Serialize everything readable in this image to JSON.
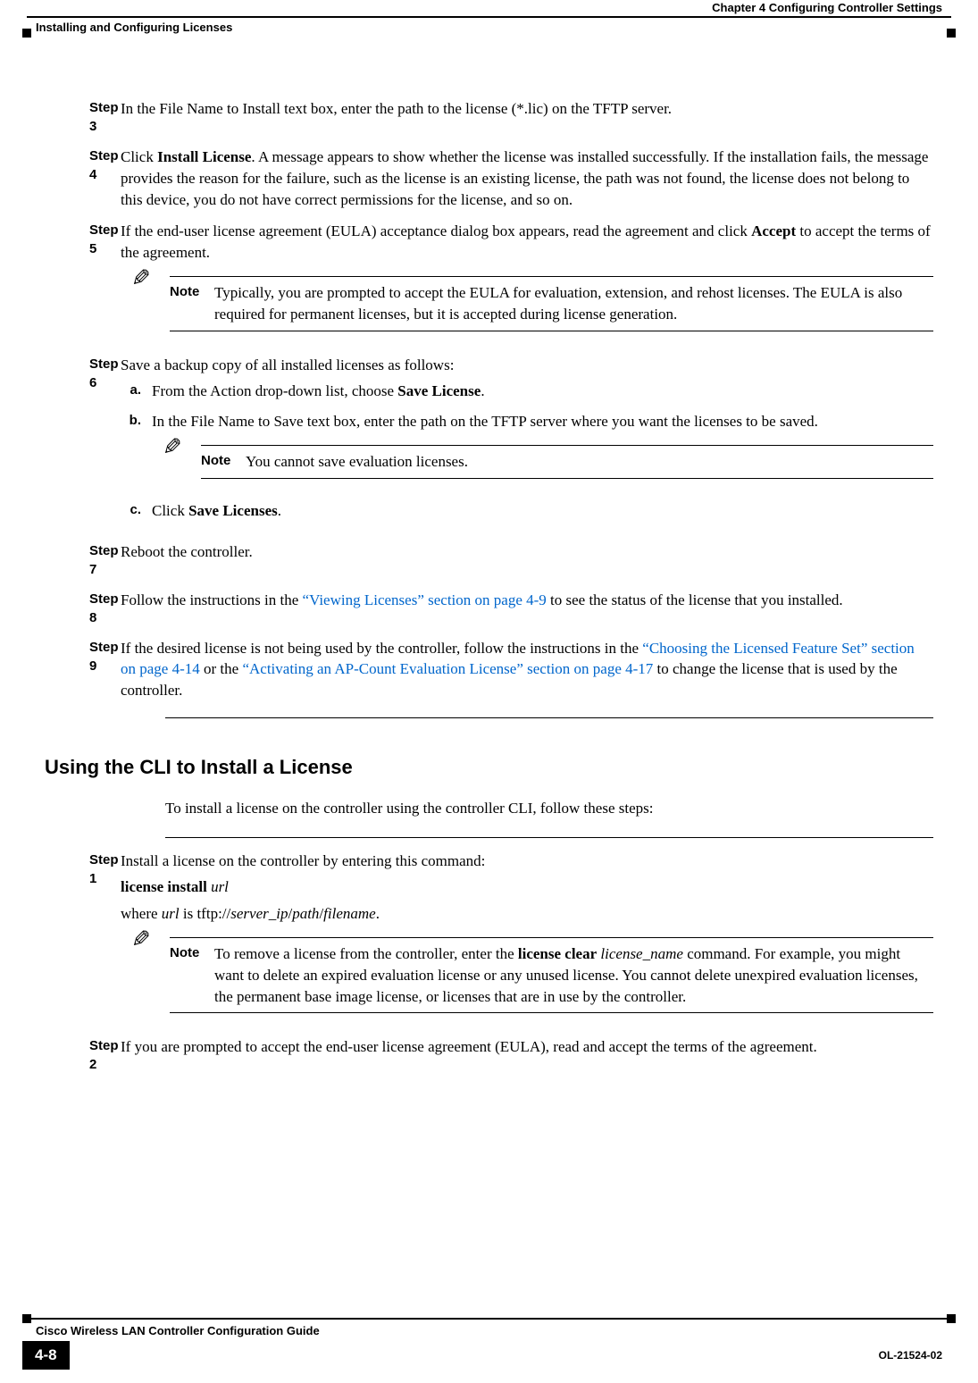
{
  "header": {
    "chapter": "Chapter 4      Configuring Controller Settings",
    "section": "Installing and Configuring Licenses"
  },
  "steps_a": {
    "s3": {
      "label": "Step 3",
      "text": "In the File Name to Install text box, enter the path to the license (*.lic) on the TFTP server."
    },
    "s4": {
      "label": "Step 4",
      "prefix": "Click ",
      "bold": "Install License",
      "suffix": ". A message appears to show whether the license was installed successfully. If the installation fails, the message provides the reason for the failure, such as the license is an existing license, the path was not found, the license does not belong to this device, you do not have correct permissions for the license, and so on."
    },
    "s5": {
      "label": "Step 5",
      "prefix": "If the end-user license agreement (EULA) acceptance dialog box appears, read the agreement and click ",
      "bold": "Accept",
      "suffix": " to accept the terms of the agreement."
    },
    "note1": {
      "label": "Note",
      "text": "Typically, you are prompted to accept the EULA for evaluation, extension, and rehost licenses. The EULA is also required for permanent licenses, but it is accepted during license generation."
    },
    "s6": {
      "label": "Step 6",
      "text": "Save a backup copy of all installed licenses as follows:",
      "a": {
        "label": "a.",
        "prefix": "From the Action drop-down list, choose ",
        "bold": "Save License",
        "suffix": "."
      },
      "b": {
        "label": "b.",
        "text": "In the File Name to Save text box, enter the path on the TFTP server where you want the licenses to be saved."
      },
      "note2": {
        "label": "Note",
        "text": "You cannot save evaluation licenses."
      },
      "c": {
        "label": "c.",
        "prefix": "Click ",
        "bold": "Save Licenses",
        "suffix": "."
      }
    },
    "s7": {
      "label": "Step 7",
      "text": "Reboot the controller."
    },
    "s8": {
      "label": "Step 8",
      "prefix": "Follow the instructions in the ",
      "link1": "“Viewing Licenses” section on page 4-9",
      "suffix": " to see the status of the license that you installed."
    },
    "s9": {
      "label": "Step 9",
      "prefix": "If the desired license is not being used by the controller, follow the instructions in the ",
      "link1": "“Choosing the Licensed Feature Set” section on page 4-14",
      "mid": " or the ",
      "link2": "“Activating an AP-Count Evaluation License” section on page 4-17",
      "suffix": " to change the license that is used by the controller."
    }
  },
  "section_b": {
    "heading": "Using the CLI to Install a License",
    "intro": "To install a license on the controller using the controller CLI, follow these steps:",
    "s1": {
      "label": "Step 1",
      "text": "Install a license on the controller by entering this command:",
      "cmd_bold": "license install ",
      "cmd_italic": "url",
      "where_prefix": "where ",
      "where_i1": "url",
      "where_mid1": " is tftp://",
      "where_i2": "server_ip",
      "where_mid2": "/",
      "where_i3": "path",
      "where_mid3": "/",
      "where_i4": "filename",
      "where_suffix": "."
    },
    "note3": {
      "label": "Note",
      "p1": "To remove a license from the controller, enter the ",
      "b1": "license clear",
      "sp": " ",
      "i1": "license_name",
      "p2": " command. For example, you might want to delete an expired evaluation license or any unused license. You cannot delete unexpired evaluation licenses, the permanent base image license, or licenses that are in use by the controller."
    },
    "s2": {
      "label": "Step 2",
      "text": "If you are prompted to accept the end-user license agreement (EULA), read and accept the terms of the agreement."
    }
  },
  "footer": {
    "title": "Cisco Wireless LAN Controller Configuration Guide",
    "page": "4-8",
    "docid": "OL-21524-02"
  }
}
